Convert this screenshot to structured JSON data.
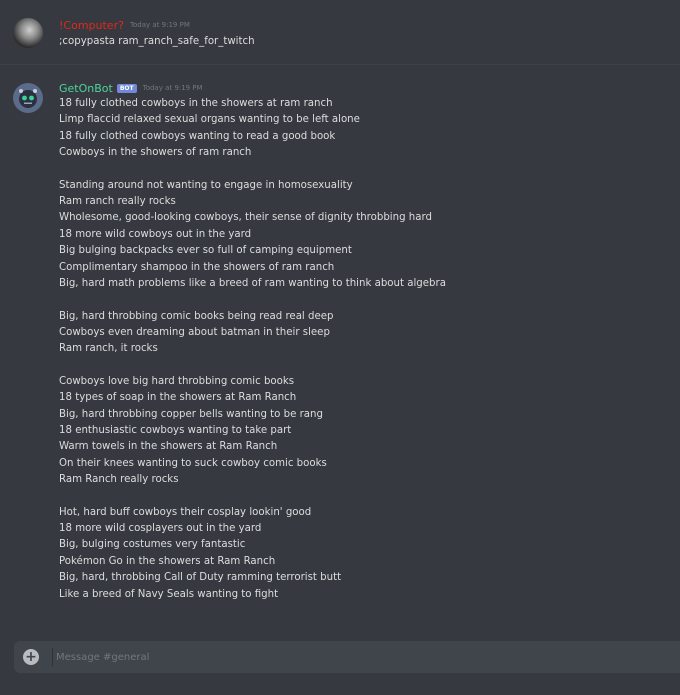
{
  "messages": [
    {
      "username": "!Computer?",
      "timestamp": "Today at 9:19 PM",
      "lines": [
        ";copypasta ram_ranch_safe_for_twitch"
      ]
    },
    {
      "username": "GetOnBot",
      "bot_tag": "BOT",
      "timestamp": "Today at 9:19 PM",
      "lines": [
        "18 fully clothed cowboys in the showers at ram ranch",
        "Limp flaccid relaxed sexual organs wanting to be left alone",
        "18 fully clothed cowboys wanting to read a good book",
        "Cowboys in the showers of ram ranch",
        "",
        "Standing around not wanting to engage in homosexuality",
        "Ram ranch really rocks",
        "Wholesome, good-looking cowboys, their sense of dignity throbbing hard",
        "18 more wild cowboys out in the yard",
        "Big bulging backpacks ever so full of camping equipment",
        "Complimentary shampoo in the showers of ram ranch",
        "Big, hard math problems like a breed of ram wanting to think about algebra",
        "",
        "Big, hard throbbing comic books being read real deep",
        "Cowboys even dreaming about batman in their sleep",
        "Ram ranch, it rocks",
        "",
        "Cowboys love big hard throbbing comic books",
        "18 types of soap in the showers at Ram Ranch",
        "Big, hard throbbing copper bells wanting to be rang",
        "18 enthusiastic cowboys wanting to take part",
        "Warm towels in the showers at Ram Ranch",
        "On their knees wanting to suck cowboy comic books",
        "Ram Ranch really rocks",
        "",
        "Hot, hard buff cowboys their cosplay lookin' good",
        "18 more wild cosplayers out in the yard",
        "Big, bulging costumes very fantastic",
        "Pokémon Go in the showers at Ram Ranch",
        "Big, hard, throbbing Call of Duty ramming terrorist butt",
        "Like a breed of Navy Seals wanting to fight"
      ]
    }
  ],
  "composer": {
    "placeholder": "Message #general",
    "value": ""
  },
  "icons": {
    "attach": "plus-circle-icon"
  }
}
